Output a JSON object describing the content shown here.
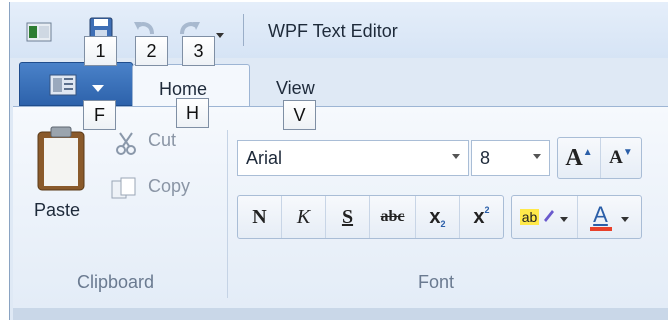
{
  "window": {
    "title": "WPF Text Editor"
  },
  "quick_access": {
    "icons": [
      "app-window-icon",
      "save-icon",
      "undo-icon",
      "redo-icon",
      "customize-dropdown-icon"
    ]
  },
  "tabs": [
    {
      "label": "Home"
    },
    {
      "label": "View"
    }
  ],
  "clipboard": {
    "paste_label": "Paste",
    "cut_label": "Cut",
    "copy_label": "Copy",
    "group_label": "Clipboard"
  },
  "font": {
    "family": "Arial",
    "size": "8",
    "group_label": "Font",
    "grow_label": "A",
    "shrink_label": "A",
    "bold_label": "N",
    "italic_label": "K",
    "underline_label": "S",
    "strike_label": "abc",
    "subscript_label": "x",
    "superscript_label": "x",
    "highlight_label": "ab",
    "color_label": "A",
    "colors": {
      "highlight": "#ffe94a",
      "font_color": "#e8402a"
    }
  },
  "keytips": {
    "k1": "1",
    "k2": "2",
    "k3": "3",
    "kF": "F",
    "kH": "H",
    "kV": "V"
  }
}
